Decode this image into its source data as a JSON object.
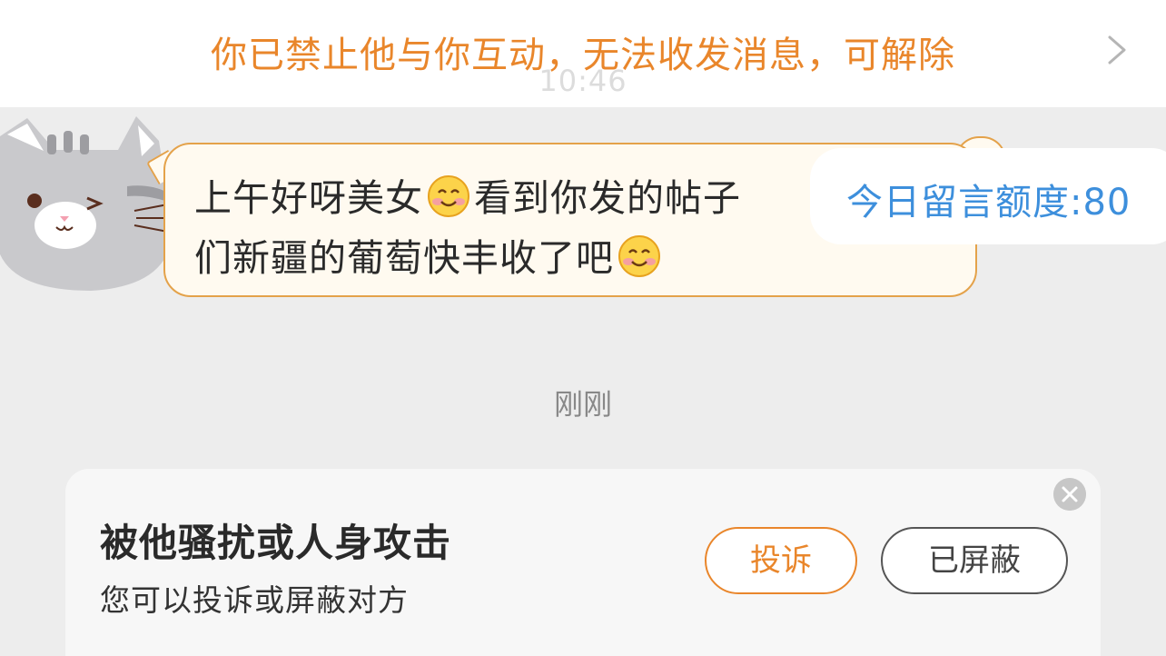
{
  "banner": {
    "text": "你已禁止他与你互动，无法收发消息，可解除",
    "faded_time": "10:46"
  },
  "chat": {
    "message_line1_a": "上午好呀美女",
    "message_line1_b": "看到你发的帖子",
    "message_line2": "们新疆的葡萄快丰收了吧",
    "quota": "今日留言额度:80",
    "timestamp": "刚刚"
  },
  "report_card": {
    "title": "被他骚扰或人身攻击",
    "subtitle": "您可以投诉或屏蔽对方",
    "complain_label": "投诉",
    "blocked_label": "已屏蔽"
  },
  "colors": {
    "accent_orange": "#e9862b",
    "quota_blue": "#3d8fdc",
    "bubble_border": "#e4a24a",
    "background": "#ededed"
  },
  "icons": [
    "chevron-right-icon",
    "cat-avatar-icon",
    "smiling-emoji-icon",
    "close-icon"
  ]
}
